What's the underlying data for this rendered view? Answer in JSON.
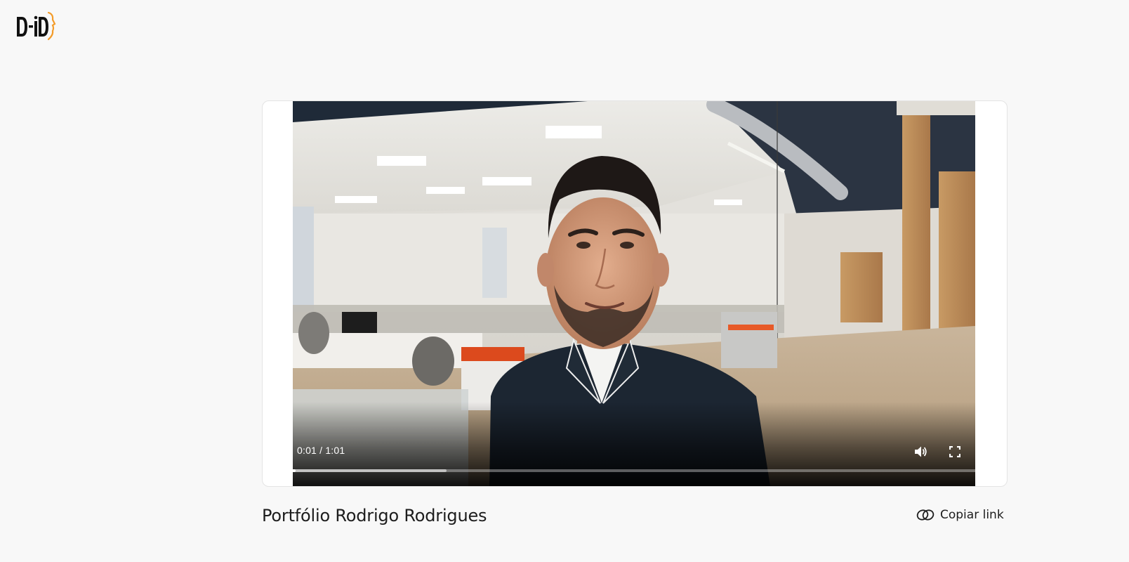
{
  "brand": {
    "logo_text": "D-ID",
    "logo_accent_color": "#f39c2a"
  },
  "video": {
    "current_time": "0:01",
    "duration": "1:01",
    "time_display": "0:01 / 1:01",
    "progress_played": 0.0306,
    "progress_buffered": 0.24,
    "play_icon": "play-icon",
    "volume_icon": "volume-icon",
    "fullscreen_icon": "fullscreen-icon",
    "more_icon": "more-vertical-icon"
  },
  "content": {
    "title": "Portfólio Rodrigo Rodrigues",
    "copy_link_label": "Copiar link",
    "copy_link_icon": "link-icon"
  }
}
